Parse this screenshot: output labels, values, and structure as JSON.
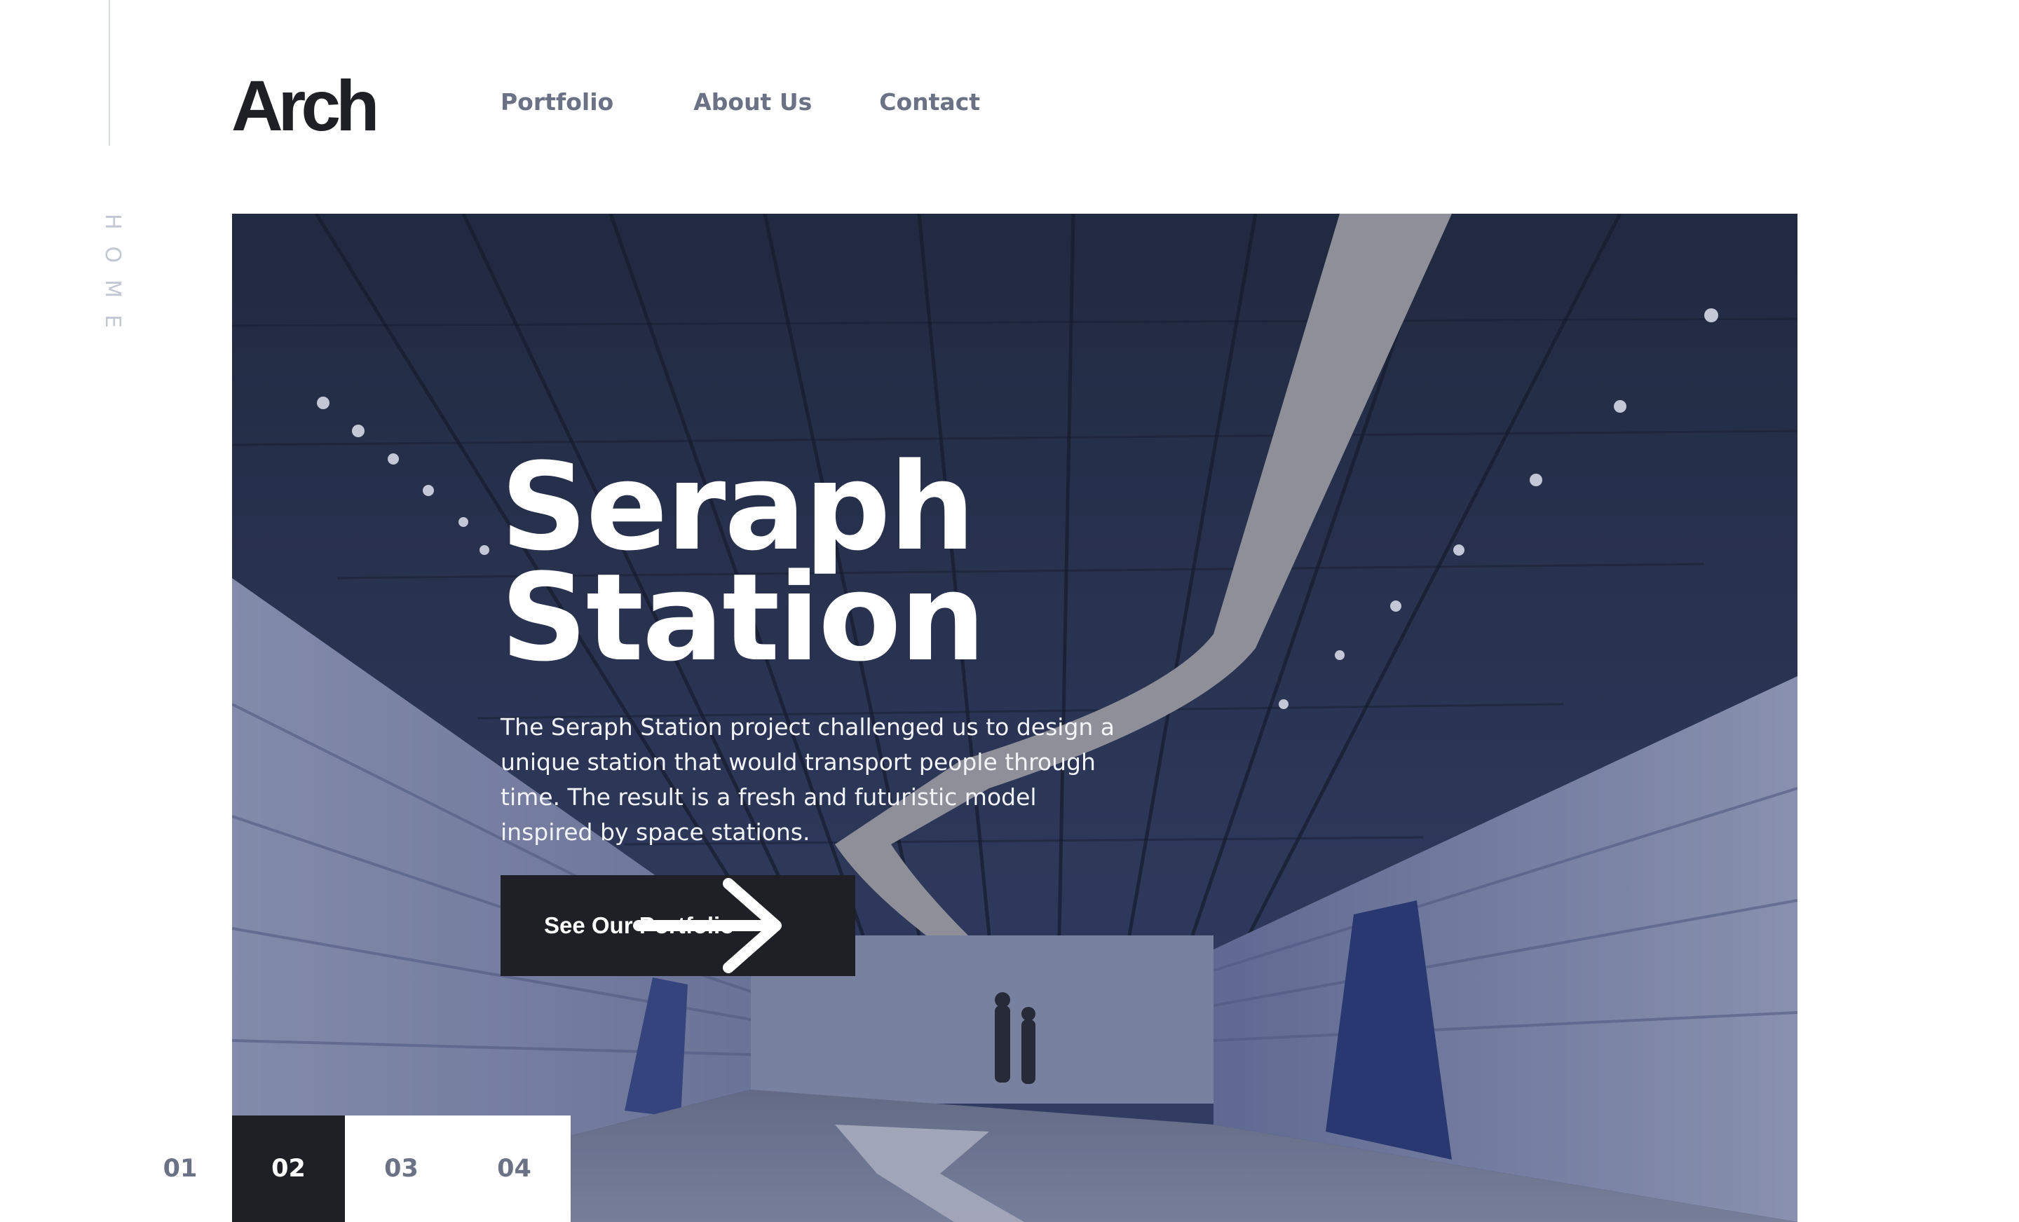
{
  "side": {
    "label": "HOME"
  },
  "brand": {
    "logo": "Arch"
  },
  "nav": {
    "items": [
      "Portfolio",
      "About Us",
      "Contact"
    ]
  },
  "hero": {
    "title_line1": "Seraph",
    "title_line2": "Station",
    "description": "The Seraph Station project challenged us to design a unique station that would transport people through time. The result is a fresh and futuristic model inspired by space stations.",
    "cta_label": "See Our Portfolio",
    "cta_icon": "arrow-right-icon"
  },
  "pager": {
    "pages": [
      "01",
      "02",
      "03",
      "04"
    ],
    "active": "02"
  },
  "colors": {
    "dark": "#1f2025",
    "nav_text": "#6b7285",
    "muted": "#c3c7d2",
    "white": "#ffffff"
  }
}
